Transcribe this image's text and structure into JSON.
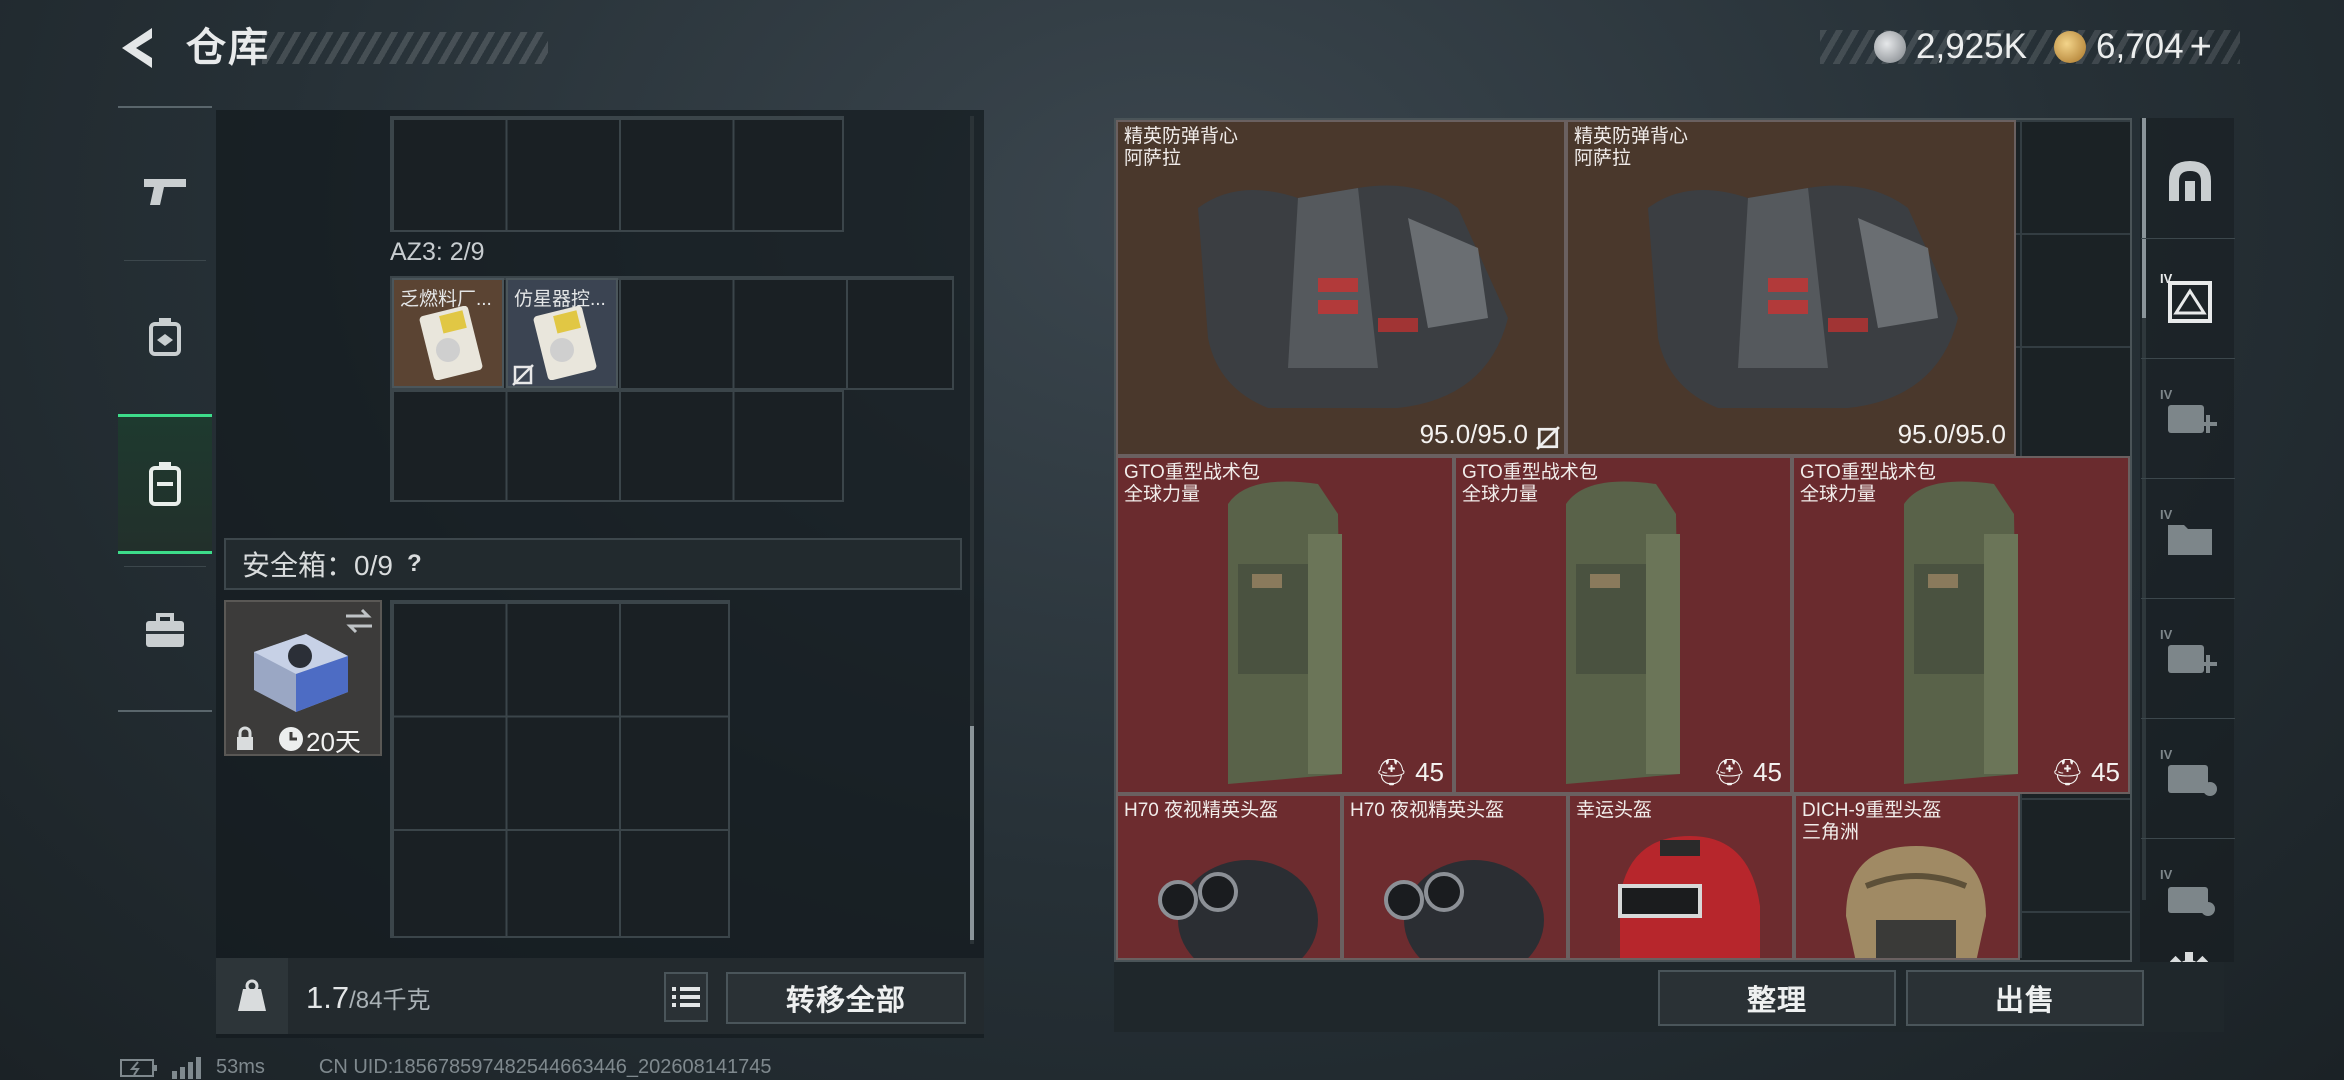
{
  "header": {
    "title": "仓库",
    "back_icon": "back-arrow-icon"
  },
  "currency": [
    {
      "icon": "silver-coin-icon",
      "value": "2,925K",
      "color": "#b8bcc0"
    },
    {
      "icon": "gold-coin-icon",
      "value": "6,704",
      "plus": "+",
      "color": "#d9a64a"
    }
  ],
  "left_tabs": [
    {
      "icon": "pistol-icon",
      "active": false
    },
    {
      "icon": "chest-rig-icon",
      "active": false
    },
    {
      "icon": "backpack-icon",
      "active": true
    },
    {
      "icon": "briefcase-icon",
      "active": false
    }
  ],
  "backpack": {
    "az3_label": "AZ3: 2/9",
    "items": [
      {
        "name": "乏燃料厂...",
        "locked": false
      },
      {
        "name": "仿星器控...",
        "locked": true
      }
    ]
  },
  "safe": {
    "header": "安全箱：0/9",
    "help": "?",
    "timer": "20天"
  },
  "weight": {
    "current": "1.7",
    "max": "/84千克"
  },
  "buttons": {
    "transfer_all": "转移全部",
    "sort": "整理",
    "sell": "出售"
  },
  "stash": {
    "vests": [
      {
        "name": "精英防弹背心\n阿萨拉",
        "durability": "95.0/95.0",
        "no_insure": true
      },
      {
        "name": "精英防弹背心\n阿萨拉",
        "durability": "95.0/95.0",
        "no_insure": false
      }
    ],
    "bags": [
      {
        "name": "GTO重型战术包\n全球力量",
        "capacity": "45"
      },
      {
        "name": "GTO重型战术包\n全球力量",
        "capacity": "45"
      },
      {
        "name": "GTO重型战术包\n全球力量",
        "capacity": "45"
      }
    ],
    "helmets": [
      {
        "name": "H70 夜视精英头盔"
      },
      {
        "name": "H70 夜视精英头盔"
      },
      {
        "name": "幸运头盔"
      },
      {
        "name": "DICH-9重型头盔\n三角洲"
      }
    ]
  },
  "right_tabs": [
    {
      "icon": "dome-icon"
    },
    {
      "icon": "iv-equipment-icon",
      "level": "IV"
    },
    {
      "icon": "iv-medkit-add-icon",
      "level": "IV"
    },
    {
      "icon": "iv-folder-icon",
      "level": "IV"
    },
    {
      "icon": "iv-medkit-icon",
      "level": "IV"
    },
    {
      "icon": "iv-container-icon",
      "level": "IV"
    },
    {
      "icon": "iv-case-icon",
      "level": "IV"
    }
  ],
  "status": {
    "ping": "53ms",
    "uid": "CN UID:185678597482544663446_202608141745"
  }
}
